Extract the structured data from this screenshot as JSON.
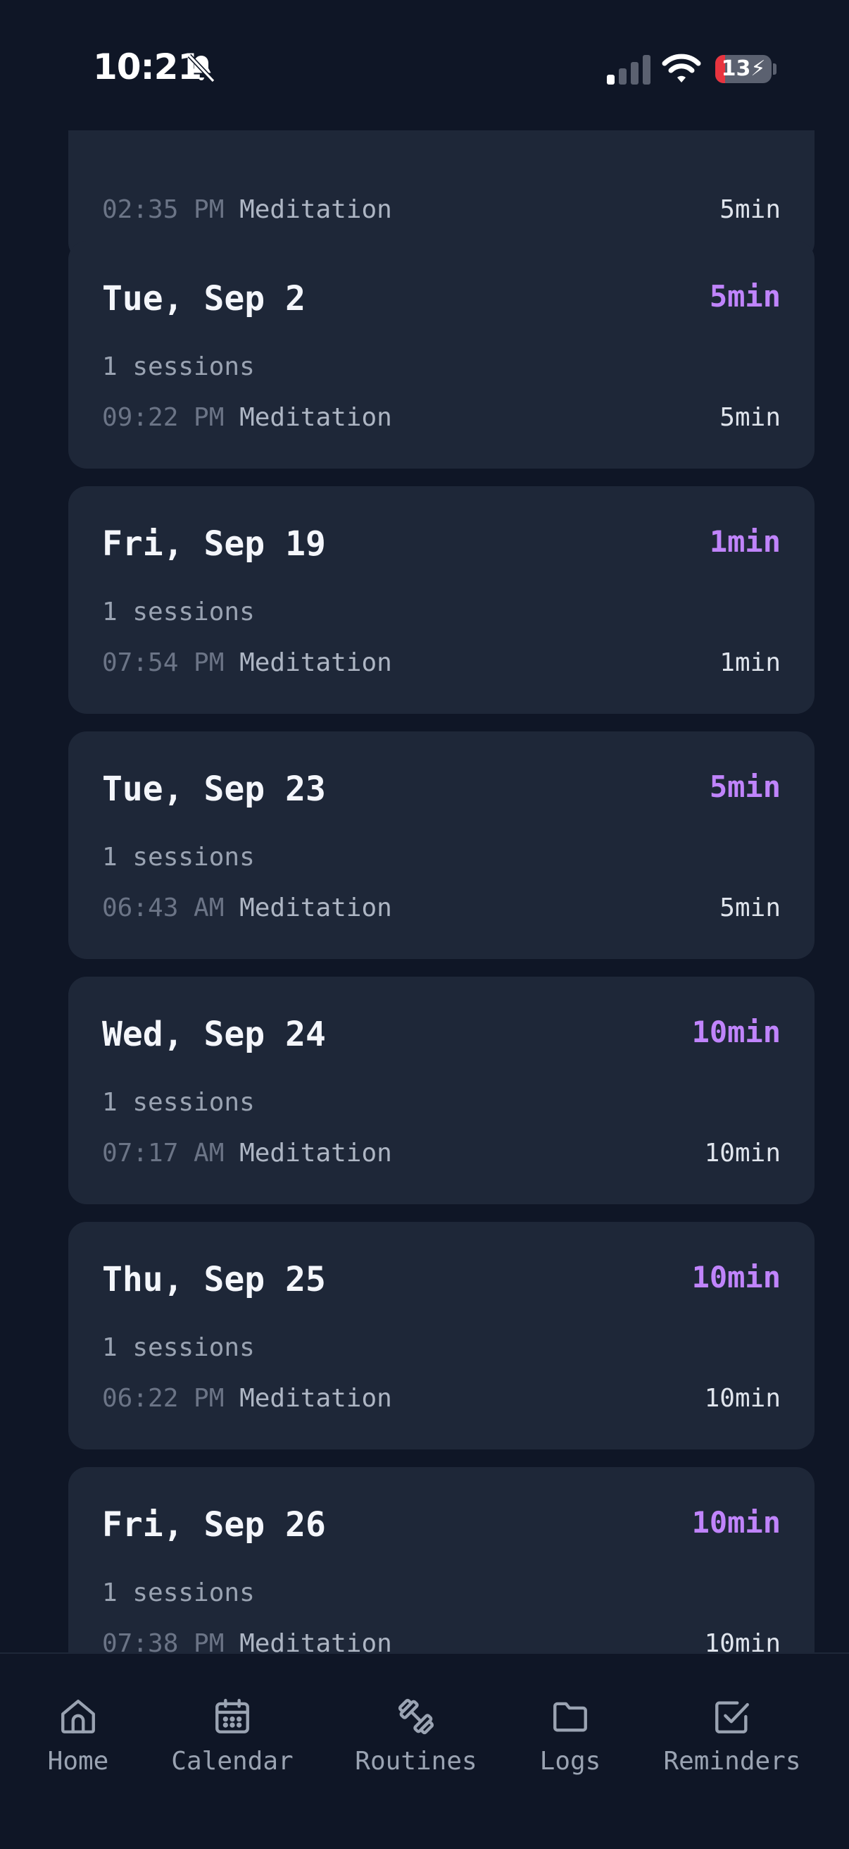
{
  "status_bar": {
    "time": "10:21",
    "battery": "13"
  },
  "cards": [
    {
      "date": "",
      "total": "",
      "count": "",
      "session_time": "02:35 PM",
      "session_name": "Meditation",
      "session_duration": "5min"
    },
    {
      "date": "Tue, Sep 2",
      "total": "5min",
      "count": "1 sessions",
      "session_time": "09:22 PM",
      "session_name": "Meditation",
      "session_duration": "5min"
    },
    {
      "date": "Fri, Sep 19",
      "total": "1min",
      "count": "1 sessions",
      "session_time": "07:54 PM",
      "session_name": "Meditation",
      "session_duration": "1min"
    },
    {
      "date": "Tue, Sep 23",
      "total": "5min",
      "count": "1 sessions",
      "session_time": "06:43 AM",
      "session_name": "Meditation",
      "session_duration": "5min"
    },
    {
      "date": "Wed, Sep 24",
      "total": "10min",
      "count": "1 sessions",
      "session_time": "07:17 AM",
      "session_name": "Meditation",
      "session_duration": "10min"
    },
    {
      "date": "Thu, Sep 25",
      "total": "10min",
      "count": "1 sessions",
      "session_time": "06:22 PM",
      "session_name": "Meditation",
      "session_duration": "10min"
    },
    {
      "date": "Fri, Sep 26",
      "total": "10min",
      "count": "1 sessions",
      "session_time": "07:38 PM",
      "session_name": "Meditation",
      "session_duration": "10min"
    }
  ],
  "nav": [
    {
      "label": "Home",
      "icon": "home-icon"
    },
    {
      "label": "Calendar",
      "icon": "calendar-icon"
    },
    {
      "label": "Routines",
      "icon": "dumbbell-icon"
    },
    {
      "label": "Logs",
      "icon": "folder-icon"
    },
    {
      "label": "Reminders",
      "icon": "checkbox-icon"
    }
  ],
  "colors": {
    "background": "#0f1626",
    "card": "#1e2738",
    "accent": "#c084fc"
  }
}
